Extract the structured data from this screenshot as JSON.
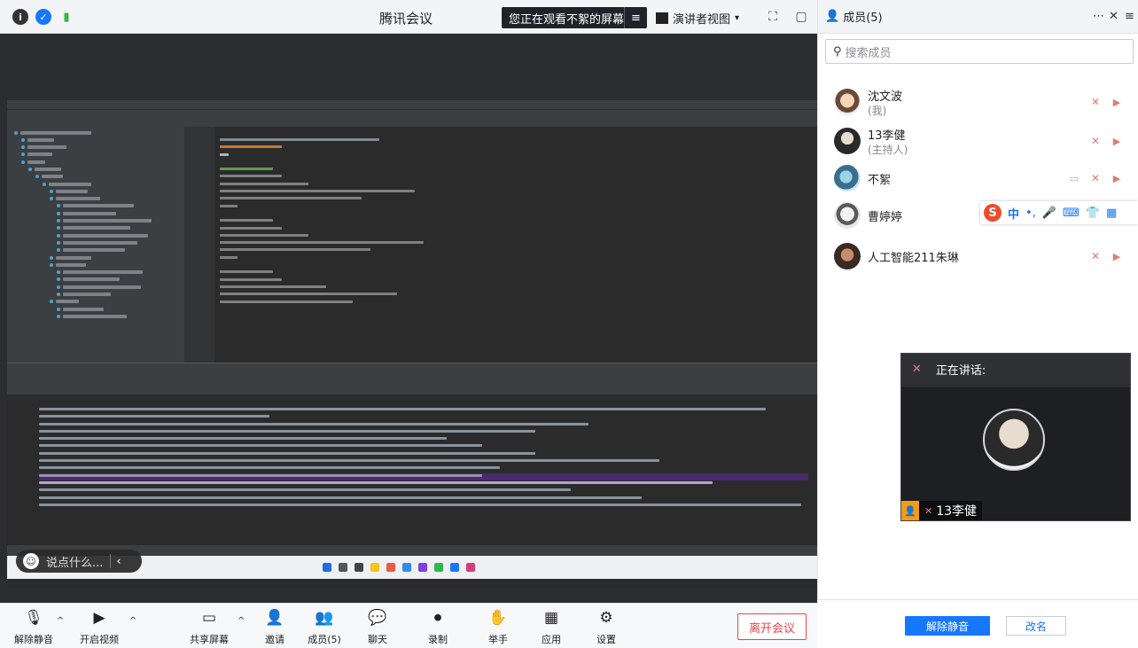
{
  "topbar": {
    "title": "腾讯会议",
    "watching": "您正在观看不絮的屏幕",
    "view_mode": "演讲者视图"
  },
  "chat_overlay": {
    "placeholder": "说点什么..."
  },
  "toolbar": {
    "mute": "解除静音",
    "video": "开启视频",
    "share": "共享屏幕",
    "invite": "邀请",
    "members": "成员(5)",
    "chat": "聊天",
    "record": "录制",
    "raise_hand": "举手",
    "apps": "应用",
    "settings": "设置",
    "leave": "离开会议"
  },
  "panel": {
    "title": "成员(5)",
    "search_placeholder": "搜索成员",
    "members": [
      {
        "name": "沈文波",
        "role": "(我)"
      },
      {
        "name": "13李健",
        "role": "(主持人)"
      },
      {
        "name": "不絮",
        "role": ""
      },
      {
        "name": "曹婷婷",
        "role": ""
      },
      {
        "name": "人工智能211朱琳",
        "role": ""
      }
    ],
    "unmute_all": "解除静音",
    "rename": "改名"
  },
  "ime": {
    "mode": "中"
  },
  "speaker": {
    "label": "正在讲话:",
    "name": "13李健"
  },
  "colors": {
    "accent": "#1677ff",
    "danger": "#e8454a",
    "muted_icon": "#e07b7b"
  }
}
